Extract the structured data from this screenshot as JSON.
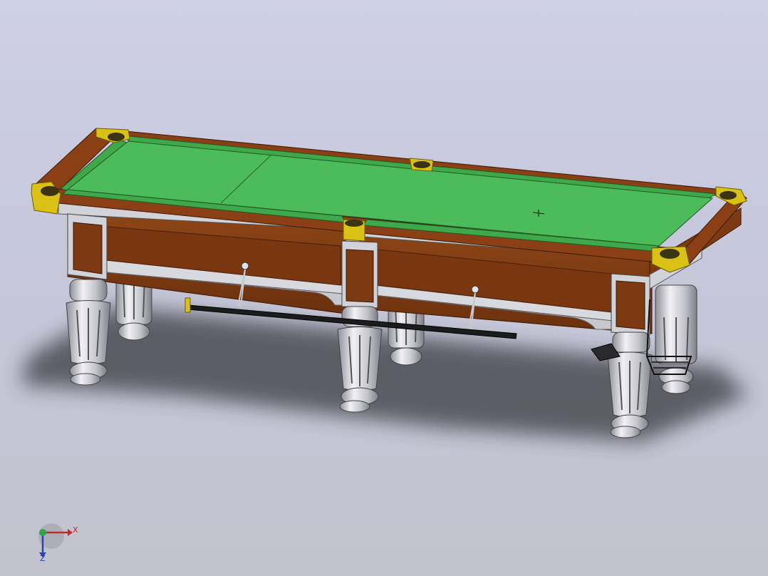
{
  "viewport": {
    "background_top": "#cfd0e6",
    "background_bottom": "#c2c3cc"
  },
  "model": {
    "cloth_color": "#4cbb5a",
    "cushion_color": "#3fa84b",
    "rail_wood_color": "#8a3f14",
    "apron_wood_color": "#7d3a12",
    "pocket_trim_color": "#d9c213",
    "frame_silver_color": "#d2d3d9",
    "leg_silver_color": "#c9cad2",
    "cue_color": "#1c1c1c",
    "shadow_color": "#3a3a40"
  },
  "triad": {
    "x_label": "X",
    "z_label": "Z",
    "x_color": "#c0282a",
    "y_color": "#2aa84a",
    "z_color": "#2a3fb8"
  }
}
